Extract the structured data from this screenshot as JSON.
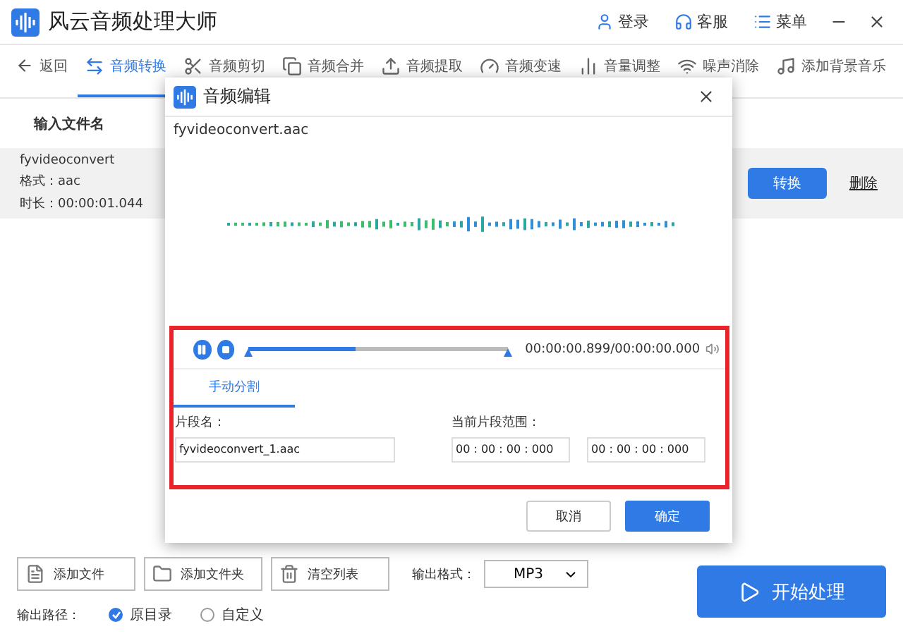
{
  "app": {
    "title": "风云音频处理大师",
    "header_actions": [
      {
        "label": "登录",
        "kind": "user"
      },
      {
        "label": "客服",
        "kind": "support"
      },
      {
        "label": "菜单",
        "kind": "menu"
      }
    ]
  },
  "toolbar": {
    "back": "返回",
    "tabs": [
      {
        "label": "音频转换",
        "kind": "convert",
        "selected": true
      },
      {
        "label": "音频剪切",
        "kind": "cut",
        "selected": false
      },
      {
        "label": "音频合并",
        "kind": "merge",
        "selected": false
      },
      {
        "label": "音频提取",
        "kind": "extract",
        "selected": false
      },
      {
        "label": "音频变速",
        "kind": "speed",
        "selected": false
      },
      {
        "label": "音量调整",
        "kind": "volume",
        "selected": false
      },
      {
        "label": "噪声消除",
        "kind": "noise",
        "selected": false
      },
      {
        "label": "添加背景音乐",
        "kind": "music",
        "selected": false
      }
    ]
  },
  "file_list": {
    "column": "输入文件名",
    "files": [
      {
        "name": "fyvideoconvert",
        "format": "格式：aac",
        "duration": "时长：00:00:01.044",
        "convert": "转换",
        "delete": "删除"
      }
    ]
  },
  "bottom": {
    "buttons": [
      {
        "label": "添加文件",
        "kind": "file"
      },
      {
        "label": "添加文件夹",
        "kind": "folder"
      },
      {
        "label": "清空列表",
        "kind": "clear"
      }
    ],
    "format_label": "输出格式：",
    "format": "MP3",
    "start": "开始处理",
    "path_label": "输出路径：",
    "path_options": [
      {
        "label": "原目录",
        "selected": true
      },
      {
        "label": "自定义",
        "selected": false
      }
    ]
  },
  "dialog": {
    "title": "音频编辑",
    "filename": "fyvideoconvert.aac",
    "player": {
      "level": 0.41,
      "time": "00:00:00.899/00:00:00.000"
    },
    "tabs": [
      {
        "label": "手动分割",
        "selected": true
      }
    ],
    "segment_name_label": "片段名：",
    "segment_name": "fyvideoconvert_1.aac",
    "range_label": "当前片段范围：",
    "range_start": "00 : 00 : 00 : 000",
    "range_end": "00 : 00 : 00 : 000",
    "cancel": "取消",
    "ok": "确定"
  }
}
